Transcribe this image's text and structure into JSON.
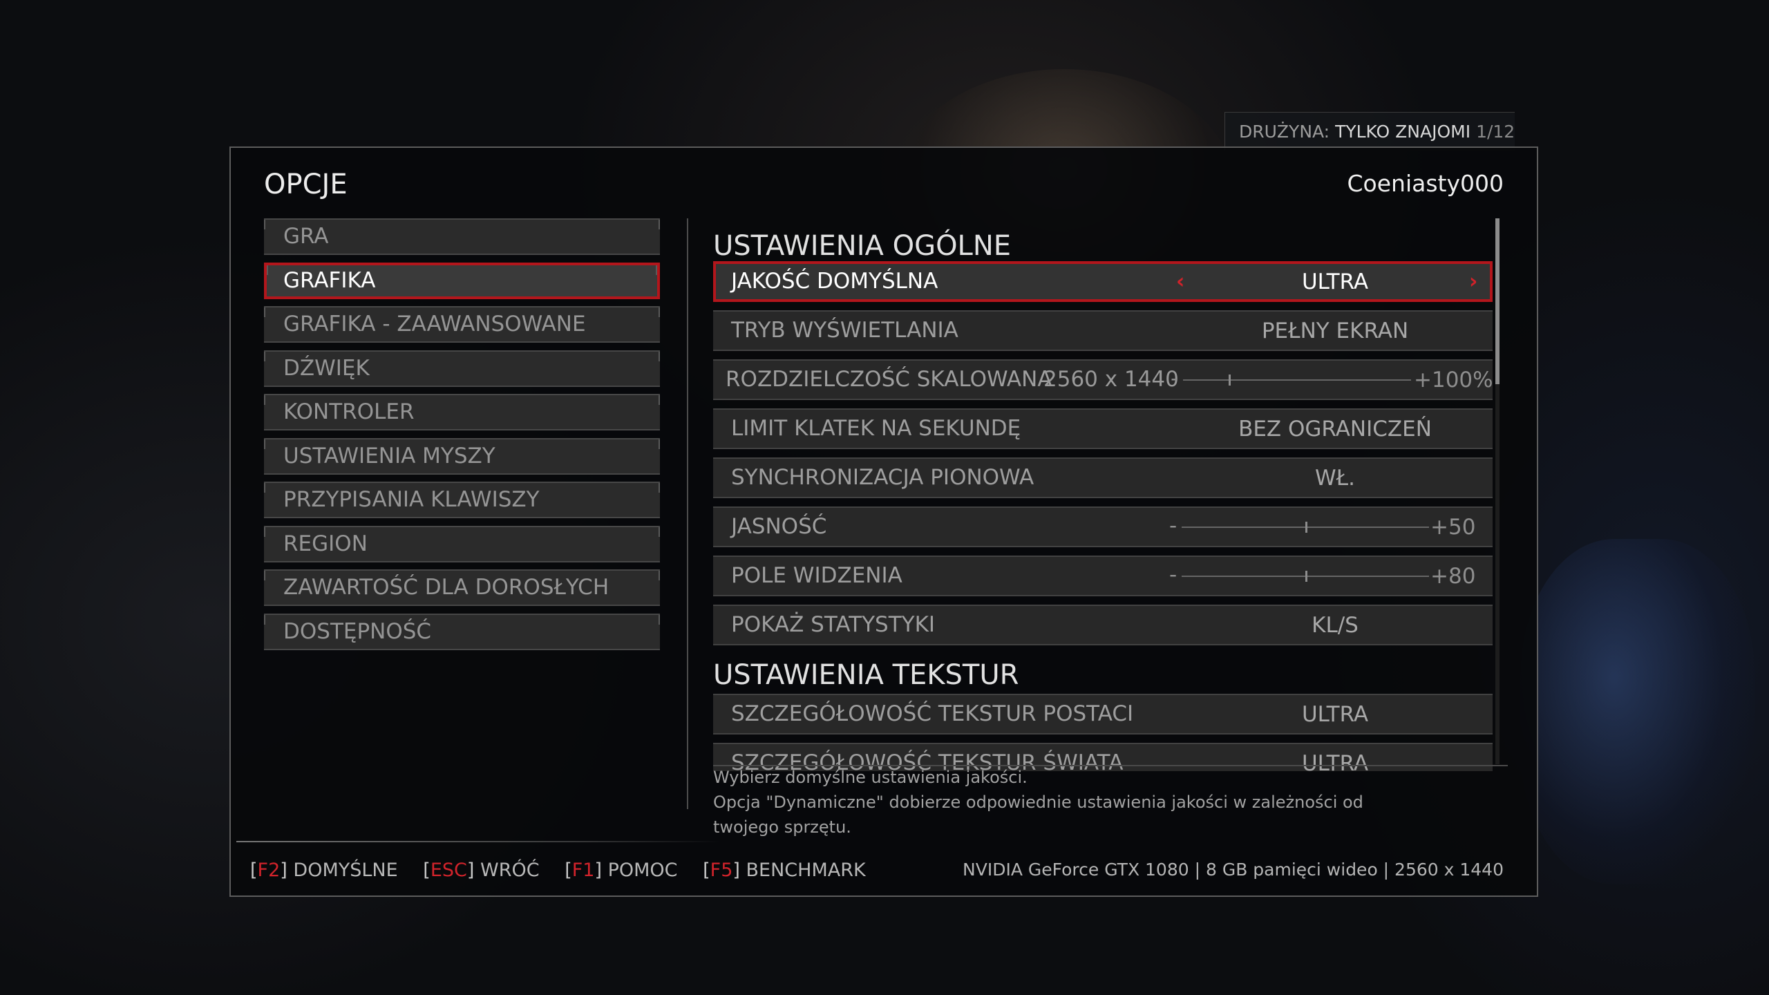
{
  "party": {
    "label": "DRUŻYNA:",
    "value": "TYLKO ZNAJOMI",
    "count": "1/12"
  },
  "header": {
    "title": "OPCJE",
    "username": "Coeniasty000"
  },
  "nav": {
    "items": [
      {
        "label": "GRA"
      },
      {
        "label": "GRAFIKA"
      },
      {
        "label": "GRAFIKA - ZAAWANSOWANE"
      },
      {
        "label": "DŹWIĘK"
      },
      {
        "label": "KONTROLER"
      },
      {
        "label": "USTAWIENIA MYSZY"
      },
      {
        "label": "PRZYPISANIA KLAWISZY"
      },
      {
        "label": "REGION"
      },
      {
        "label": "ZAWARTOŚĆ DLA DOROSŁYCH"
      },
      {
        "label": "DOSTĘPNOŚĆ"
      }
    ],
    "active_index": 1
  },
  "sections": {
    "general": {
      "title": "USTAWIENIA OGÓLNE",
      "quality": {
        "label": "JAKOŚĆ DOMYŚLNA",
        "value": "ULTRA"
      },
      "display_mode": {
        "label": "TRYB WYŚWIETLANIA",
        "value": "PEŁNY EKRAN"
      },
      "scaled_resolution": {
        "label": "ROZDZIELCZOŚĆ SKALOWANA",
        "resolution": "2560 x 1440",
        "minus": "-",
        "value_text": "+100%",
        "level": 0.2
      },
      "fps_limit": {
        "label": "LIMIT KLATEK NA SEKUNDĘ",
        "value": "BEZ OGRANICZEŃ"
      },
      "vsync": {
        "label": "SYNCHRONIZACJA PIONOWA",
        "value": "WŁ."
      },
      "brightness": {
        "label": "JASNOŚĆ",
        "minus": "-",
        "value_text": "+50",
        "level": 0.5
      },
      "fov": {
        "label": "POLE WIDZENIA",
        "minus": "-",
        "value_text": "+80",
        "level": 0.5
      },
      "show_stats": {
        "label": "POKAŻ STATYSTYKI",
        "value": "KL/S"
      }
    },
    "textures": {
      "title": "USTAWIENIA TEKSTUR",
      "character_detail": {
        "label": "SZCZEGÓŁOWOŚĆ TEKSTUR POSTACI",
        "value": "ULTRA"
      },
      "world_detail": {
        "label": "SZCZEGÓŁOWOŚĆ TEKSTUR ŚWIATA",
        "value": "ULTRA"
      }
    }
  },
  "description": {
    "line1": "Wybierz domyślne ustawienia jakości.",
    "line2": "Opcja \"Dynamiczne\" dobierze odpowiednie ustawienia jakości w zależności od",
    "line3": "twojego sprzętu."
  },
  "footer": {
    "hints": [
      {
        "key": "F2",
        "label": "DOMYŚLNE"
      },
      {
        "key": "ESC",
        "label": "WRÓĆ"
      },
      {
        "key": "F1",
        "label": "POMOC"
      },
      {
        "key": "F5",
        "label": "BENCHMARK"
      }
    ],
    "gpu_info": "NVIDIA GeForce GTX 1080 | 8 GB pamięci wideo | 2560 x 1440"
  },
  "colors": {
    "accent": "#b3161c",
    "key_red": "#d1232b"
  },
  "icons": {
    "arrow_left": "chevron-left-icon",
    "arrow_right": "chevron-right-icon"
  }
}
